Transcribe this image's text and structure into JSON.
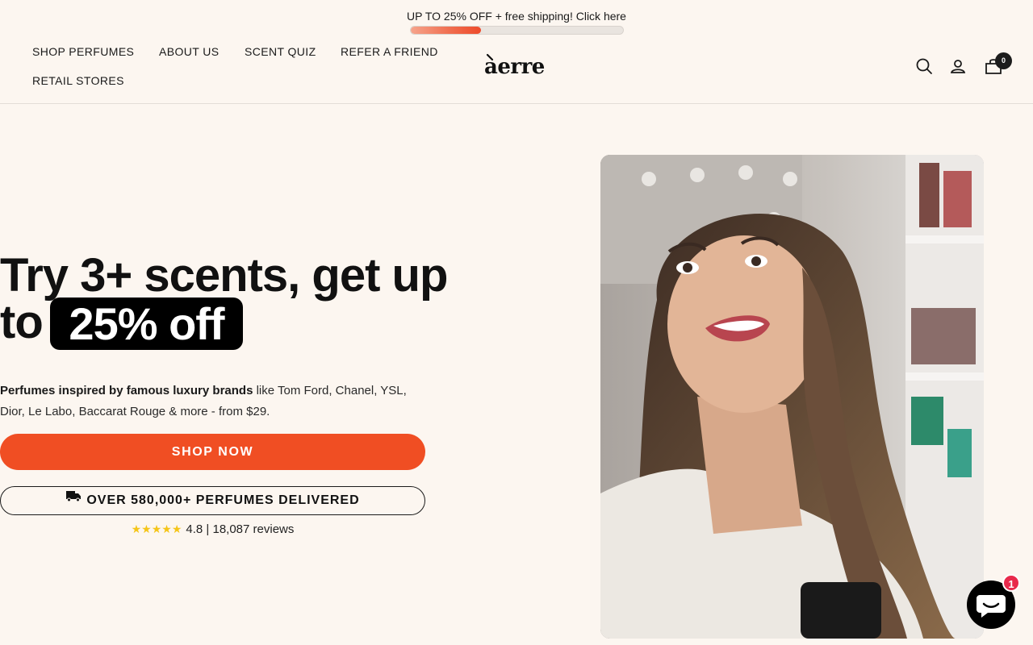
{
  "announcement": {
    "text": "UP TO 25% OFF + free shipping! Click here",
    "progress": 0.33
  },
  "nav": {
    "items": [
      "SHOP PERFUMES",
      "ABOUT US",
      "SCENT QUIZ",
      "REFER A FRIEND",
      "RETAIL STORES"
    ]
  },
  "logo": {
    "text": "aerre",
    "accent": "̀"
  },
  "header": {
    "cart_count": "0"
  },
  "hero": {
    "title_line1": "Try 3+ scents, get up",
    "title_line2_prefix": "to",
    "title_highlight": "25% off",
    "desc_bold": "Perfumes inspired by famous luxury brands",
    "desc_rest": " like Tom Ford, Chanel, YSL, Dior, Le Labo, Baccarat Rouge & more - from $29.",
    "cta_label": "SHOP NOW",
    "delivered_label": "OVER 580,000+ PERFUMES DELIVERED",
    "stars": "★★★★★",
    "rating_text": "4.8 | 18,087 reviews"
  },
  "chat": {
    "badge": "1"
  },
  "colors": {
    "background": "#fcf6f0",
    "accent": "#f04e23",
    "star": "#f5c518",
    "badge_red": "#e8294b"
  },
  "icons": [
    "search-icon",
    "account-icon",
    "cart-icon",
    "truck-icon",
    "chat-icon"
  ]
}
